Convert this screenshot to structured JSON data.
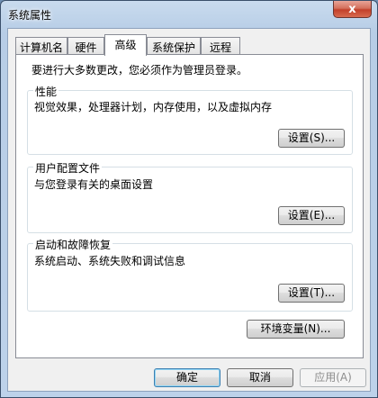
{
  "window": {
    "title": "系统属性",
    "close_symbol": "x"
  },
  "tabs": [
    {
      "label": "计算机名"
    },
    {
      "label": "硬件"
    },
    {
      "label": "高级"
    },
    {
      "label": "系统保护"
    },
    {
      "label": "远程"
    }
  ],
  "active_tab": "高级",
  "advanced": {
    "intro": "要进行大多数更改，您必须作为管理员登录。",
    "performance": {
      "title": "性能",
      "description": "视觉效果，处理器计划，内存使用，以及虚拟内存",
      "settings_button": "设置(S)..."
    },
    "user_profiles": {
      "title": "用户配置文件",
      "description": "与您登录有关的桌面设置",
      "settings_button": "设置(E)..."
    },
    "startup_recovery": {
      "title": "启动和故障恢复",
      "description": "系统启动、系统失败和调试信息",
      "settings_button": "设置(T)..."
    },
    "env_vars_button": "环境变量(N)..."
  },
  "footer": {
    "ok": "确定",
    "cancel": "取消",
    "apply": "应用(A)"
  }
}
